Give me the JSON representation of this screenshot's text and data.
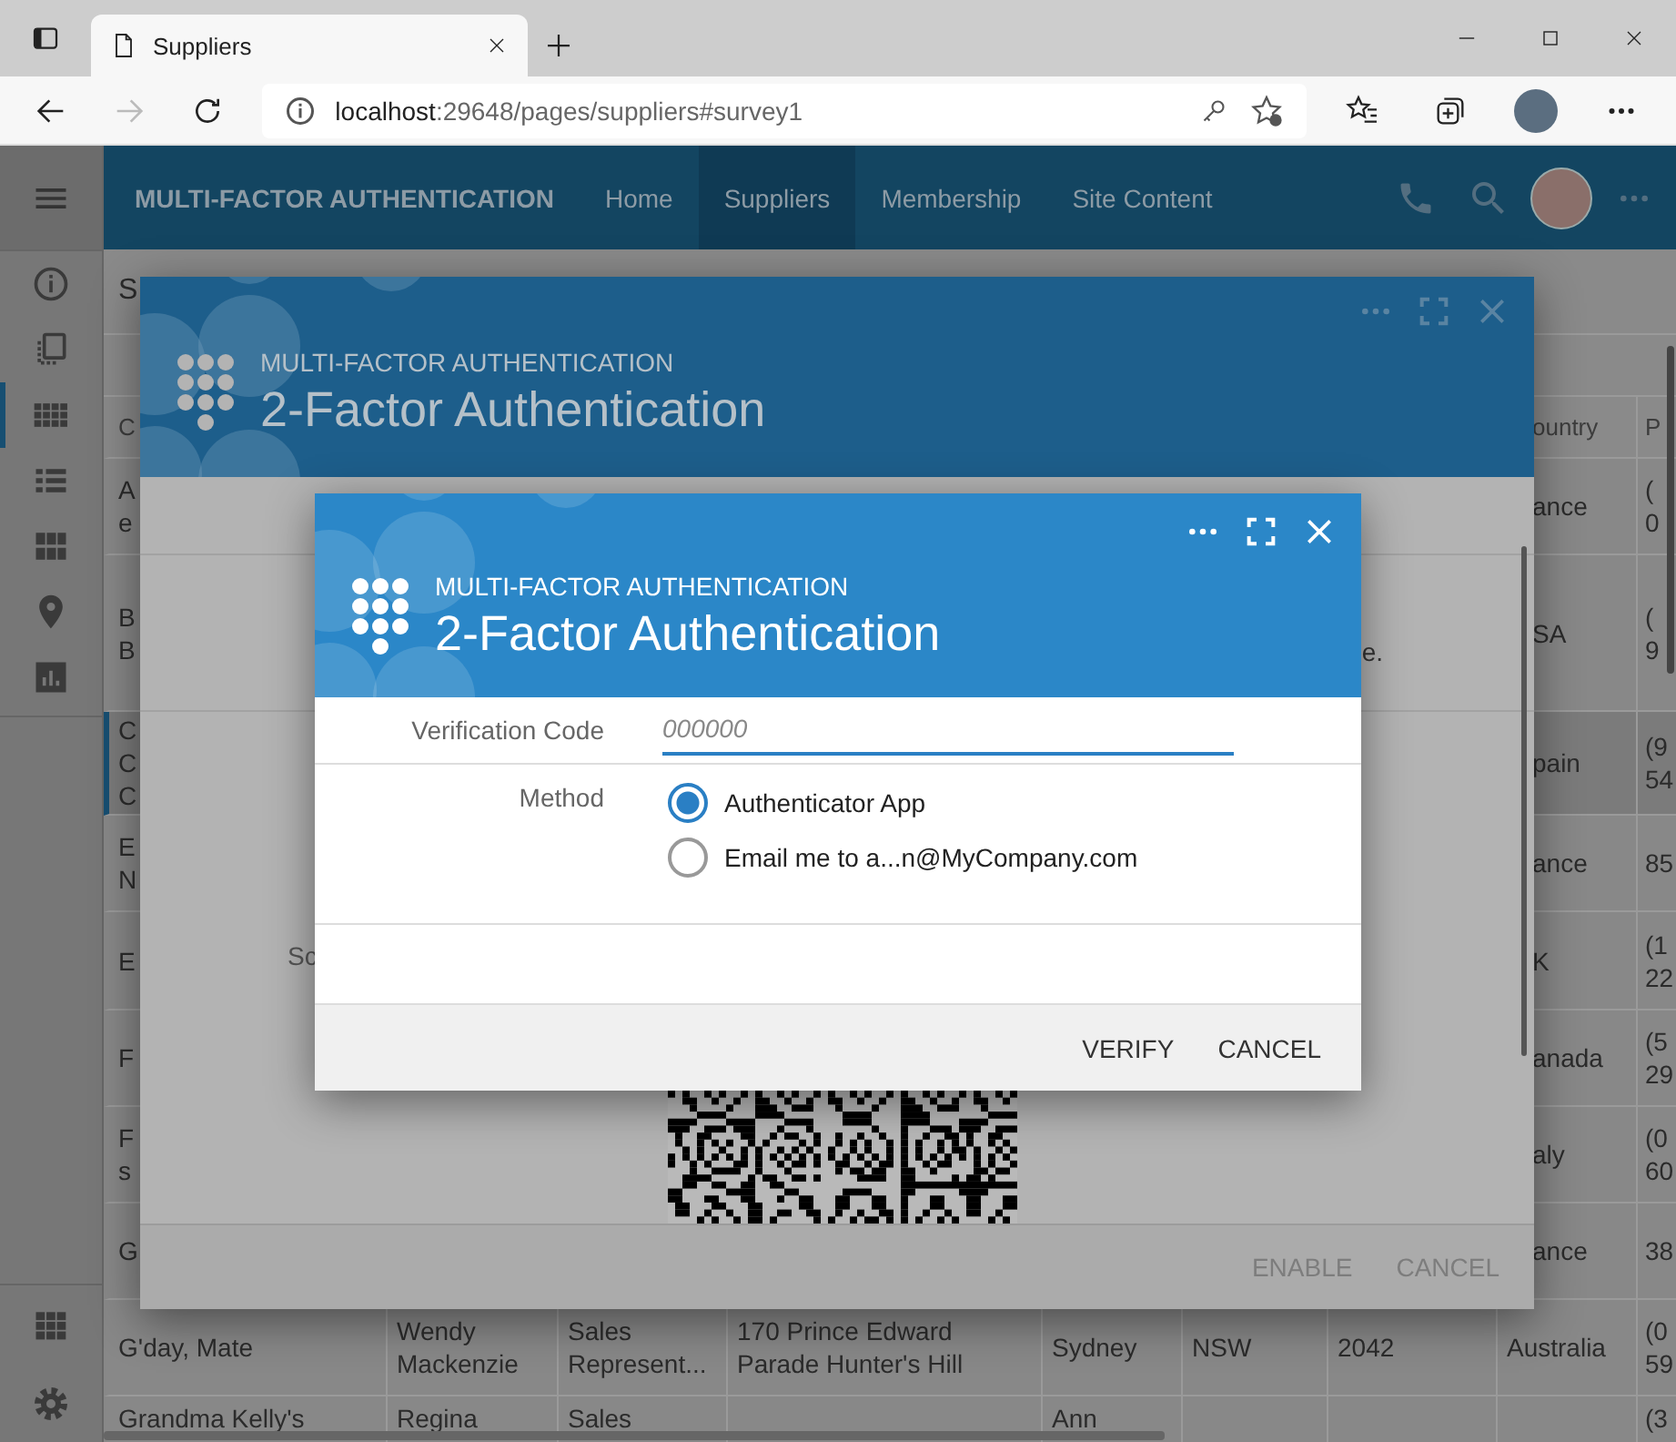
{
  "browser": {
    "tab_title": "Suppliers",
    "url_host": "localhost",
    "url_rest": ":29648/pages/suppliers#survey1",
    "forward_disabled": true
  },
  "app": {
    "brand": "MULTI-FACTOR AUTHENTICATION",
    "nav": [
      {
        "label": "Home",
        "selected": false
      },
      {
        "label": "Suppliers",
        "selected": true
      },
      {
        "label": "Membership",
        "selected": false
      },
      {
        "label": "Site Content",
        "selected": false
      }
    ]
  },
  "sidebar": {
    "items": [
      {
        "selected": false
      },
      {
        "selected": false
      },
      {
        "selected": true
      },
      {
        "selected": false
      },
      {
        "selected": false
      },
      {
        "selected": false
      },
      {
        "selected": false
      }
    ]
  },
  "table": {
    "title": "S",
    "header": {
      "company": "C",
      "country": "ountry",
      "phone": "P"
    },
    "rows": [
      {
        "kind": "covered",
        "selected": false,
        "company": "A\ne",
        "country": "ance",
        "phone": "(\n0"
      },
      {
        "kind": "covered",
        "selected": false,
        "company": "B\nB",
        "country": "SA",
        "phone": "(\n9"
      },
      {
        "kind": "covered",
        "selected": true,
        "company": "C\nC\nC",
        "country": "pain",
        "phone": "(9\n54"
      },
      {
        "kind": "covered",
        "selected": false,
        "company": "E\nN",
        "country": "ance",
        "phone": "85"
      },
      {
        "kind": "covered",
        "selected": false,
        "company": "E",
        "country": "K",
        "phone": "(1\n22"
      },
      {
        "kind": "covered",
        "selected": false,
        "company": "F",
        "country": "anada",
        "phone": "(5\n29"
      },
      {
        "kind": "covered",
        "selected": false,
        "company": "F\ns",
        "country": "aly",
        "phone": "(0\n60"
      },
      {
        "kind": "covered",
        "selected": false,
        "company": "G",
        "country": "ance",
        "phone": "38"
      },
      {
        "kind": "full",
        "selected": false,
        "company": "G'day, Mate",
        "contact": "Wendy\nMackenzie",
        "title": "Sales\nRepresent...",
        "address": "170 Prince Edward\nParade Hunter's Hill",
        "city": "Sydney",
        "region": "NSW",
        "postal": "2042",
        "country": "Australia",
        "phone": "(0\n59"
      },
      {
        "kind": "full",
        "selected": false,
        "company": "Grandma Kelly's",
        "contact": "Regina",
        "title": "Sales",
        "city": "Ann",
        "phone": "(3"
      }
    ]
  },
  "outer_dialog": {
    "subtitle": "MULTI-FACTOR AUTHENTICATION",
    "title": "2-Factor Authentication",
    "side_text": "e.",
    "scan_label": "Sc",
    "actions": [
      {
        "label": "ENABLE"
      },
      {
        "label": "CANCEL"
      }
    ]
  },
  "dialog": {
    "subtitle": "MULTI-FACTOR AUTHENTICATION",
    "title": "2-Factor Authentication",
    "fields": [
      {
        "kind": "text",
        "label": "Verification Code",
        "placeholder": "000000"
      },
      {
        "kind": "radio",
        "label": "Method",
        "options": [
          {
            "label": "Authenticator App",
            "selected": true
          },
          {
            "label": "Email me to a...n@MyCompany.com",
            "selected": false
          }
        ]
      }
    ],
    "actions": [
      {
        "label": "VERIFY"
      },
      {
        "label": "CANCEL"
      }
    ]
  }
}
